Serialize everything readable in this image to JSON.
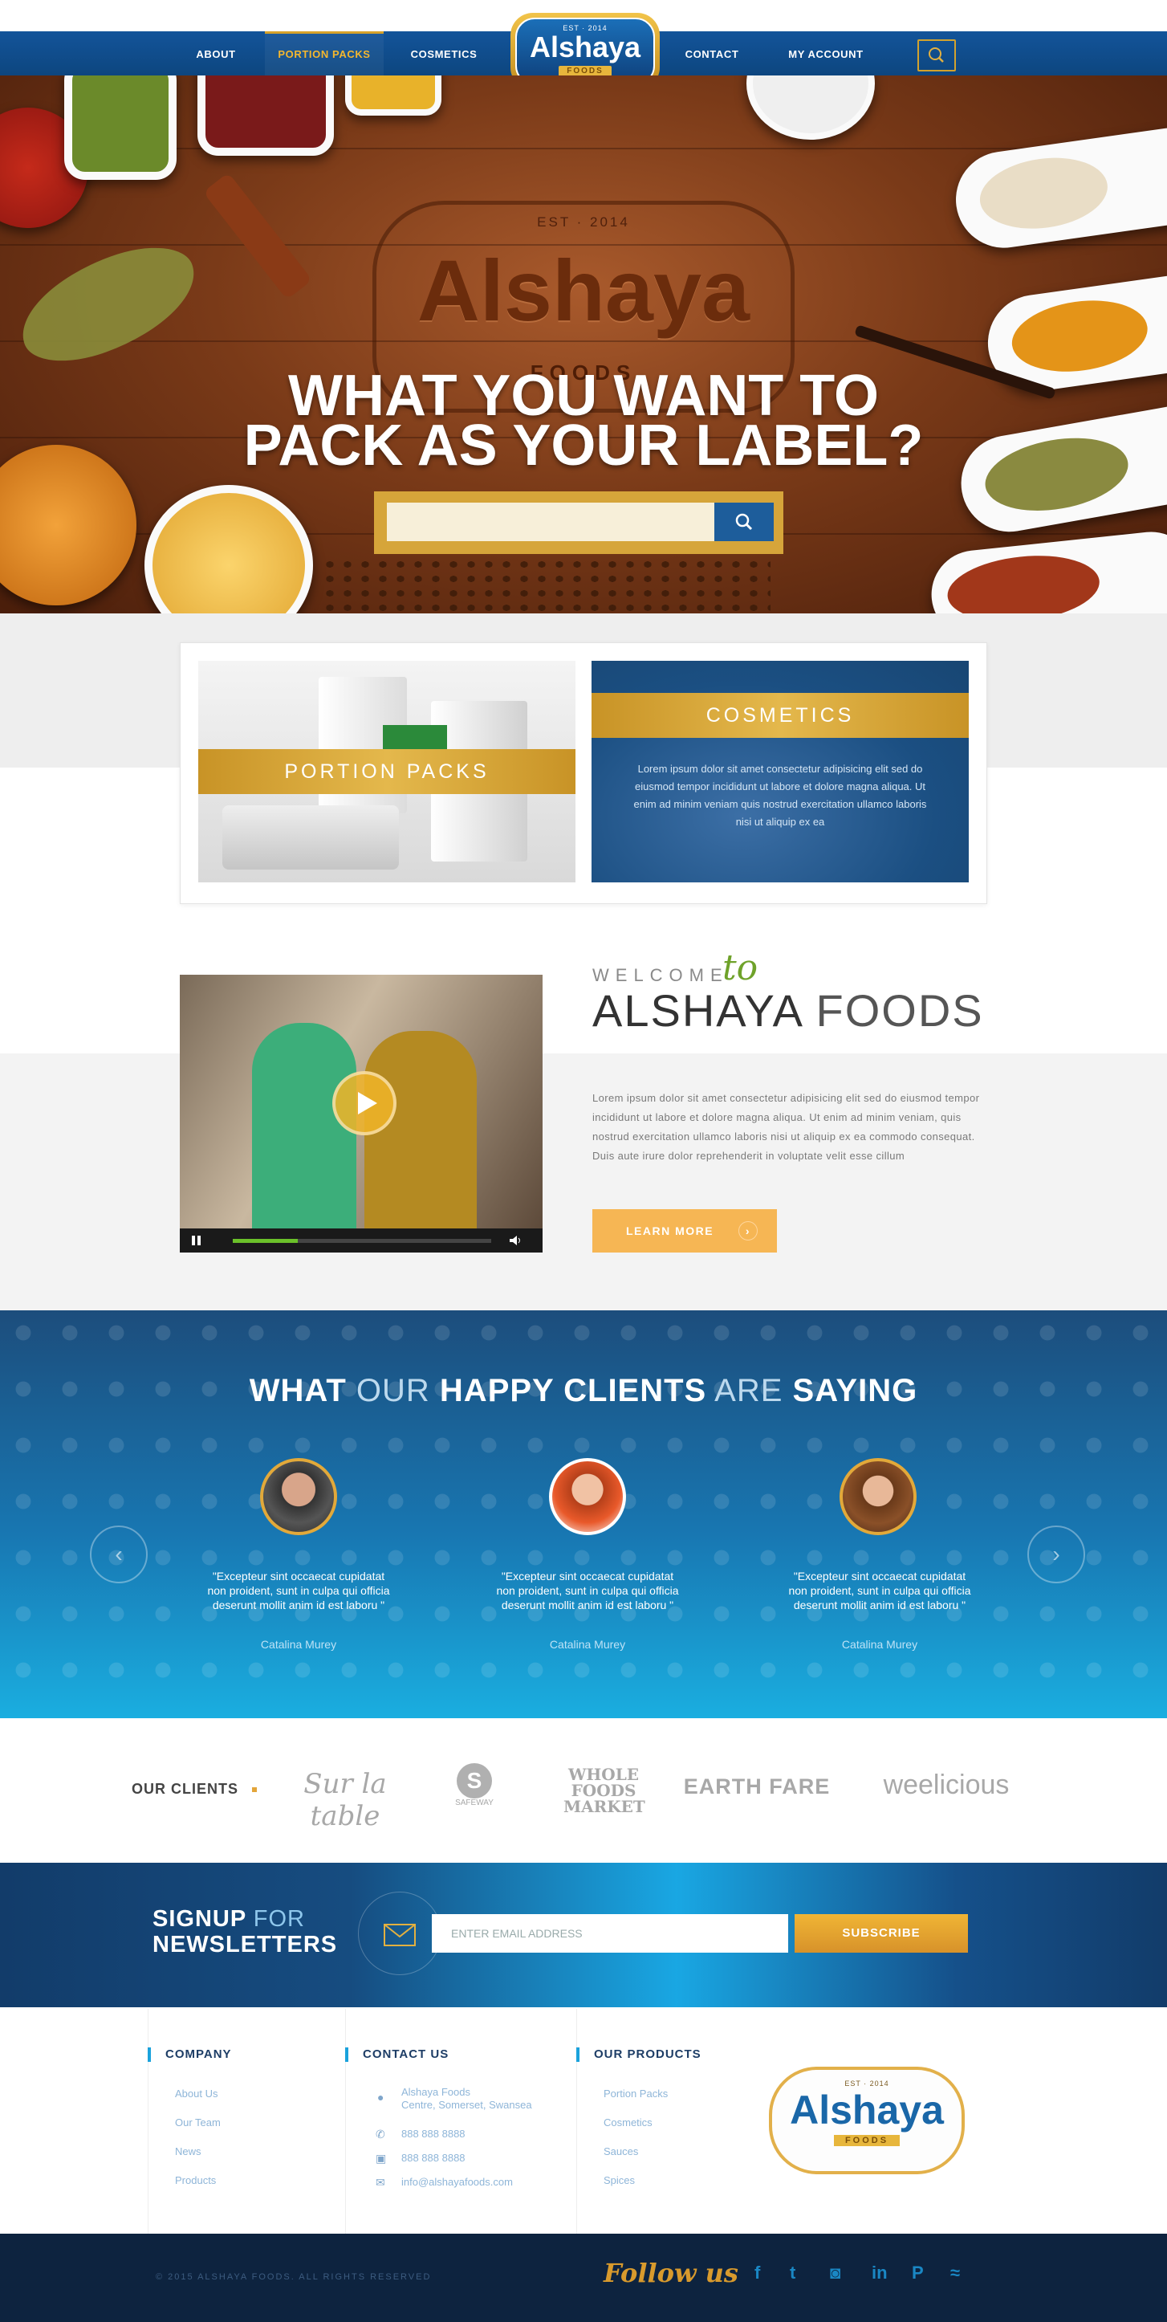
{
  "nav": {
    "items": [
      "ABOUT",
      "PORTION PACKS",
      "COSMETICS",
      "CONTACT",
      "MY ACCOUNT"
    ],
    "active": "PORTION PACKS",
    "logo": {
      "est": "EST · 2014",
      "name": "Alshaya",
      "foods": "FOODS"
    }
  },
  "hero": {
    "emblem_est": "EST · 2014",
    "emblem_name": "Alshaya",
    "emblem_foods": "FOODS",
    "headline_line1": "WHAT YOU WANT TO",
    "headline_line2": "PACK AS YOUR LABEL?",
    "search_placeholder": ""
  },
  "categories": {
    "portion_packs": "PORTION PACKS",
    "cosmetics": "COSMETICS",
    "cosmetics_text": "Lorem ipsum dolor sit amet consectetur adipisicing elit sed do eiusmod tempor incididunt ut labore et dolore magna aliqua. Ut enim ad minim veniam quis nostrud exercitation ullamco laboris nisi ut aliquip ex ea"
  },
  "welcome": {
    "pre": "WELCOME",
    "to": "to",
    "title": "ALSHAYA FOODS",
    "title_bold": "ALSHAYA",
    "title_light": "FOODS",
    "body": "Lorem ipsum dolor sit amet consectetur adipisicing elit sed do eiusmod tempor incididunt ut labore et dolore magna aliqua. Ut enim ad minim veniam, quis nostrud exercitation ullamco laboris nisi ut aliquip ex ea commodo consequat. Duis aute irure dolor  reprehenderit in voluptate velit esse cillum",
    "button": "LEARN MORE",
    "video_progress": 0.25
  },
  "testimonials": {
    "title_parts": [
      "WHAT",
      "OUR",
      "HAPPY CLIENTS",
      "ARE",
      "SAYING"
    ],
    "items": [
      {
        "quote": "\"Excepteur sint occaecat cupidatat non proident, sunt in culpa qui officia deserunt mollit anim id est laboru \"",
        "name": "Catalina Murey"
      },
      {
        "quote": "\"Excepteur sint occaecat cupidatat non proident, sunt in culpa qui officia deserunt mollit anim id est laboru \"",
        "name": "Catalina Murey"
      },
      {
        "quote": "\"Excepteur sint occaecat cupidatat non proident, sunt in culpa qui officia deserunt mollit anim id est laboru \"",
        "name": "Catalina Murey"
      }
    ],
    "prev": "‹",
    "next": "›"
  },
  "clients": {
    "label": "OUR CLIENTS",
    "logos": [
      "Sur la table",
      "SAFEWAY",
      "WHOLE FOODS MARKET",
      "EARTH FARE",
      "weelicious"
    ]
  },
  "newsletter": {
    "title_signup": "SIGNUP",
    "title_for": "FOR",
    "title_newsletters": "NEWSLETTERS",
    "placeholder": "ENTER EMAIL ADDRESS",
    "button": "SUBSCRIBE"
  },
  "footer": {
    "company": {
      "title": "COMPANY",
      "links": [
        "About Us",
        "Our Team",
        "News",
        "Products"
      ]
    },
    "contact": {
      "title": "CONTACT US",
      "address_line1": "Alshaya Foods",
      "address_line2": "Centre, Somerset, Swansea",
      "phone": "888 888 8888",
      "fax": "888 888 8888",
      "email": "info@alshayafoods.com"
    },
    "products": {
      "title": "OUR PRODUCTS",
      "links": [
        "Portion Packs",
        "Cosmetics",
        "Sauces",
        "Spices"
      ]
    },
    "logo": {
      "est": "EST · 2014",
      "name": "Alshaya",
      "foods": "FOODS"
    },
    "copyright": "© 2015 ALSHAYA FOODS. ALL RIGHTS RESERVED",
    "follow": "Follow us",
    "social": [
      "facebook-icon",
      "twitter-icon",
      "instagram-icon",
      "linkedin-icon",
      "pinterest-icon",
      "rss-icon"
    ]
  },
  "colors": {
    "navy": "#0f4f8f",
    "gold": "#d6a53a",
    "sky": "#1aaee0",
    "green": "#6fa22a"
  }
}
